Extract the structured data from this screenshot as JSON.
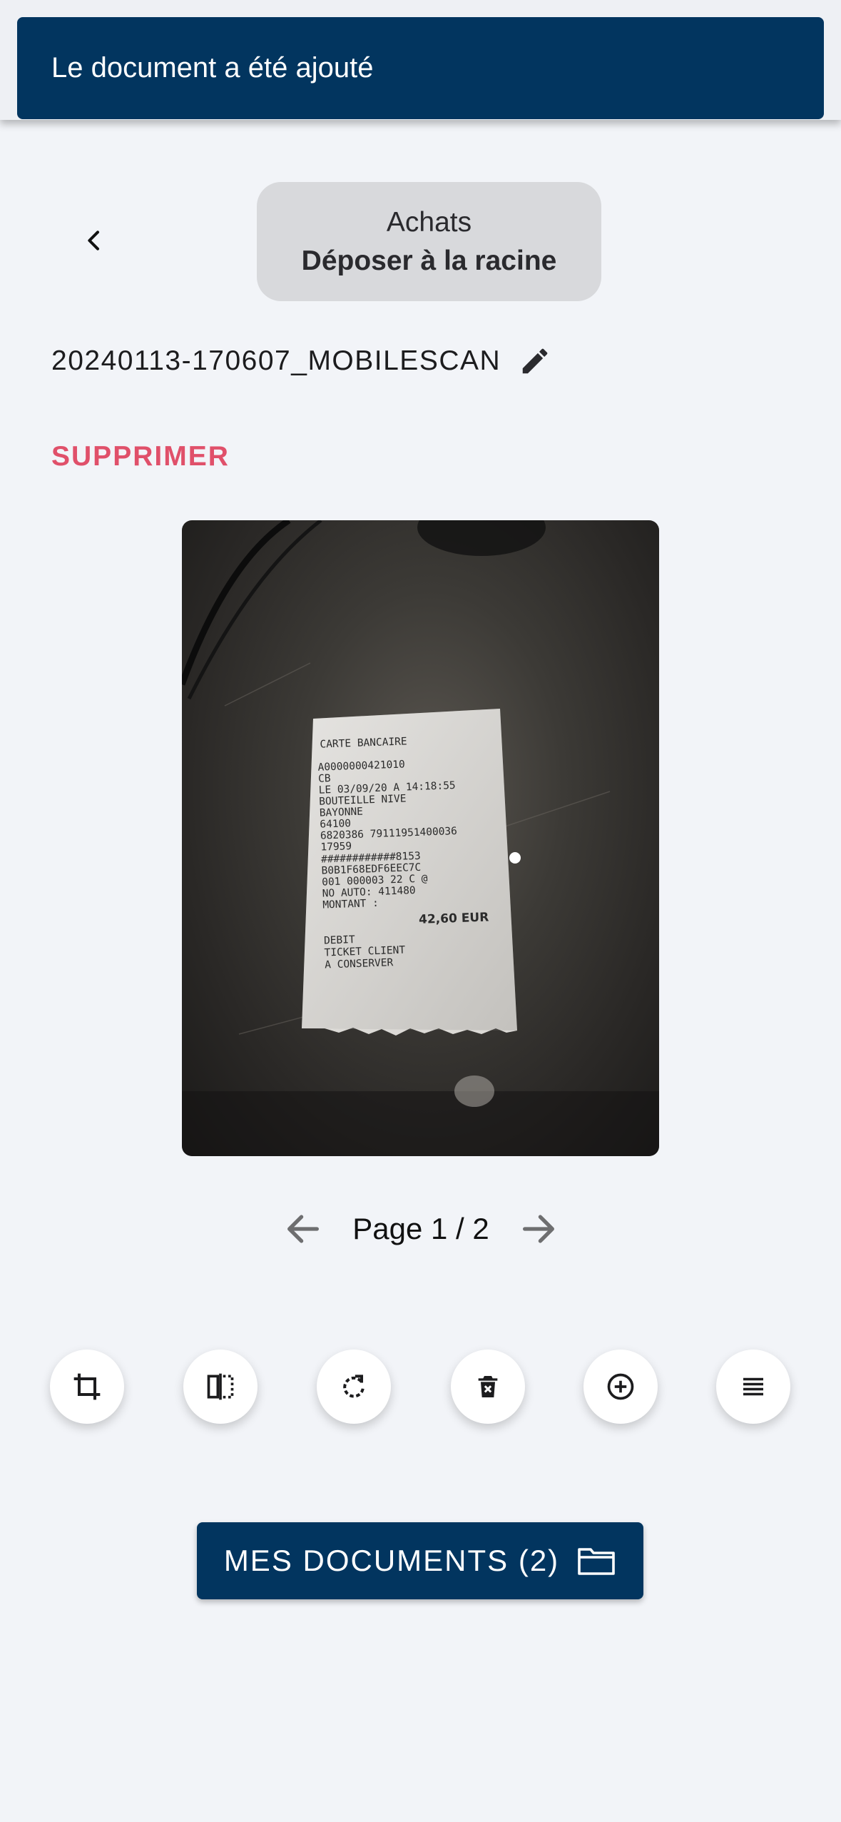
{
  "toast": {
    "message": "Le document a été ajouté"
  },
  "header": {
    "back_icon": "chevron-left-icon",
    "folder_name": "Achats",
    "folder_action": "Déposer à la racine"
  },
  "document": {
    "name": "20240113-170607_MOBILESCAN",
    "delete_label": "SUPPRIMER"
  },
  "receipt": {
    "lines": [
      "CARTE BANCAIRE",
      "A0000000421010",
      "CB",
      "LE 03/09/20 A 14:18:55",
      "BOUTEILLE NIVE",
      "BAYONNE",
      "64100",
      "6820386 79111951400036",
      "17959",
      "############8153",
      "B0B1F68EDF6EEC7C",
      "001 000003 22 C @",
      "NO AUTO: 411480",
      "MONTANT :"
    ],
    "amount": "42,60 EUR",
    "footer": [
      "DEBIT",
      "TICKET CLIENT",
      "A CONSERVER"
    ]
  },
  "pager": {
    "label": "Page 1 / 2",
    "current": 1,
    "total": 2
  },
  "tools": [
    {
      "name": "crop-button",
      "icon": "crop-icon"
    },
    {
      "name": "split-button",
      "icon": "split-icon"
    },
    {
      "name": "rotate-button",
      "icon": "rotate-icon"
    },
    {
      "name": "delete-page-button",
      "icon": "trash-icon"
    },
    {
      "name": "add-page-button",
      "icon": "plus-circle-icon"
    },
    {
      "name": "reorder-button",
      "icon": "lines-icon"
    }
  ],
  "primary_button": {
    "label": "MES DOCUMENTS (2)",
    "icon": "folder-icon"
  },
  "colors": {
    "primary": "#02355f",
    "danger": "#e0506a",
    "background": "#f2f4f8",
    "pill": "#d8d9dc"
  }
}
